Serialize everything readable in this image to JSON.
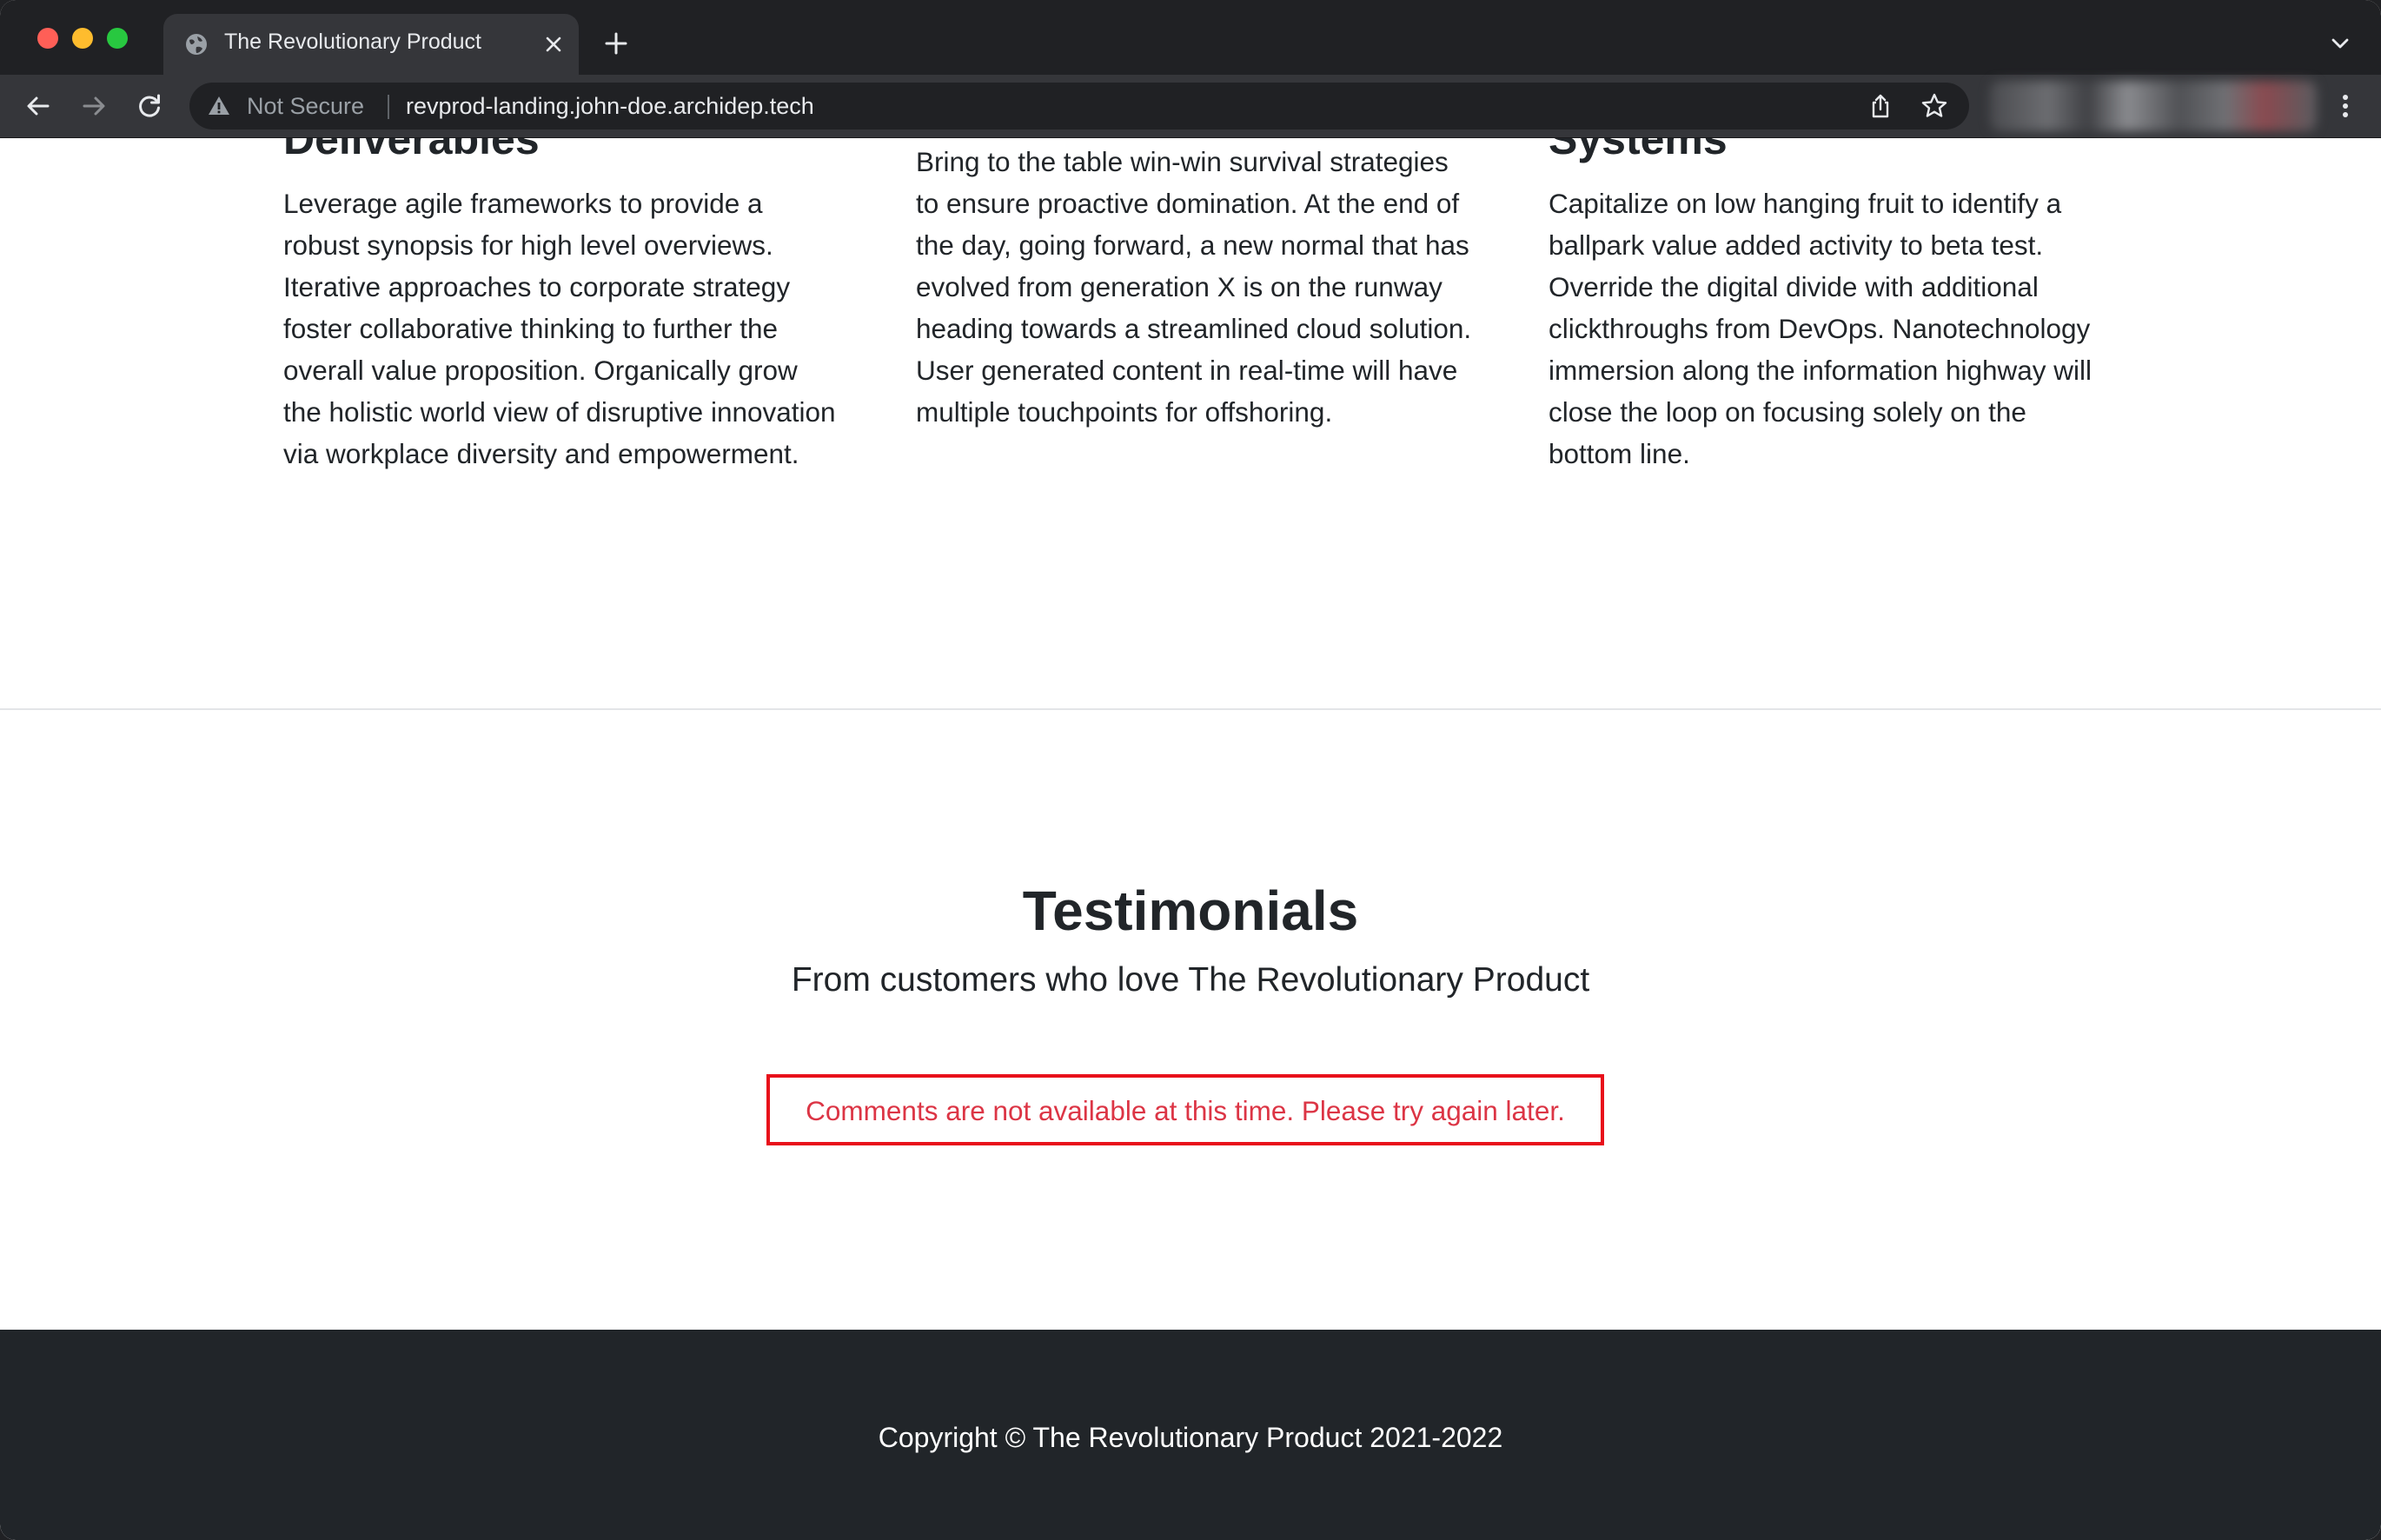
{
  "browser": {
    "tab_title": "The Revolutionary Product",
    "security_label": "Not Secure",
    "url": "revprod-landing.john-doe.archidep.tech",
    "icons": {
      "tab_favicon": "globe-icon",
      "tab_close": "close-icon",
      "new_tab": "plus-icon",
      "tab_search": "chevron-down-icon",
      "back": "arrow-left-icon",
      "forward": "arrow-right-icon",
      "reload": "reload-icon",
      "security": "warning-icon",
      "share": "share-icon",
      "bookmark": "star-icon",
      "menu": "kebab-menu-icon"
    }
  },
  "features": [
    {
      "title": "Deliverables",
      "text": "Leverage agile frameworks to provide a robust synopsis for high level overviews. Iterative approaches to corporate strategy foster collaborative thinking to further the overall value proposition. Organically grow the holistic world view of disruptive innovation via workplace diversity and empowerment."
    },
    {
      "title": "",
      "text": "Bring to the table win-win survival strategies to ensure proactive domination. At the end of the day, going forward, a new normal that has evolved from generation X is on the runway heading towards a streamlined cloud solution. User generated content in real-time will have multiple touchpoints for offshoring."
    },
    {
      "title": "Systems",
      "text": "Capitalize on low hanging fruit to identify a ballpark value added activity to beta test. Override the digital divide with additional clickthroughs from DevOps. Nanotechnology immersion along the information highway will close the loop on focusing solely on the bottom line."
    }
  ],
  "testimonials": {
    "title": "Testimonials",
    "subtitle": "From customers who love The Revolutionary Product",
    "error": "Comments are not available at this time. Please try again later."
  },
  "footer": {
    "copyright": "Copyright © The Revolutionary Product 2021-2022"
  },
  "colors": {
    "chrome_dark": "#202124",
    "chrome_toolbar": "#35363a",
    "text": "#212529",
    "error_red": "#dc3545",
    "footer_bg": "#212529"
  }
}
